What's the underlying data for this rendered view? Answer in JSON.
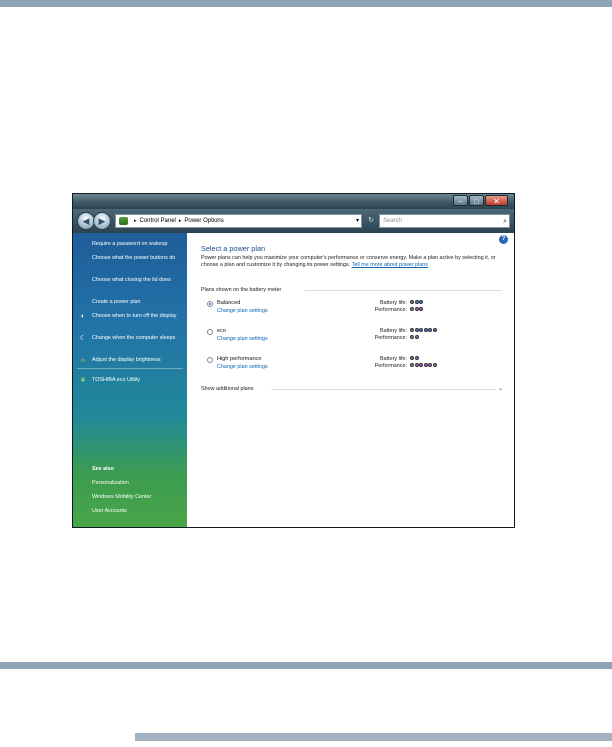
{
  "window": {
    "controls": {
      "minimize": "–",
      "maximize": "□",
      "close": "✕"
    }
  },
  "address": {
    "back": "◀",
    "forward": "▶",
    "breadcrumb": [
      "Control Panel",
      "Power Options"
    ],
    "separator": "▸",
    "dropdown": "▾",
    "refresh": "↻",
    "search_placeholder": "Search"
  },
  "sidebar": {
    "tasks": [
      {
        "label": "Require a password on wakeup"
      },
      {
        "label": "Choose what the power buttons do"
      },
      {
        "label": "Choose what closing the lid does"
      },
      {
        "label": "Create a power plan"
      },
      {
        "label": "Choose when to turn off the display",
        "icon": "display-icon"
      },
      {
        "label": "Change when the computer sleeps",
        "icon": "moon-icon"
      },
      {
        "label": "Adjust the display brightness",
        "icon": "sun-icon"
      }
    ],
    "utility": {
      "label": "TOSHIBA eco Utility",
      "icon": "leaf-icon"
    },
    "see_also": {
      "heading": "See also",
      "links": [
        "Personalization",
        "Windows Mobility Center",
        "User Accounts"
      ]
    }
  },
  "main": {
    "title": "Select a power plan",
    "intro": "Power plans can help you maximize your computer's performance or conserve energy. Make a plan active by selecting it, or choose a plan and customize it by changing its power settings.",
    "intro_link": "Tell me more about power plans",
    "section_label": "Plans shown on the battery meter",
    "battery_label": "Battery life:",
    "performance_label": "Performance:",
    "change_settings_label": "Change plan settings",
    "plans": [
      {
        "name": "Balanced",
        "selected": true,
        "battery_life": 3,
        "performance": 3
      },
      {
        "name": "eco",
        "selected": false,
        "battery_life": 6,
        "performance": 2
      },
      {
        "name": "High performance",
        "selected": false,
        "battery_life": 2,
        "performance": 6
      }
    ],
    "additional_label": "Show additional plans",
    "colors": {
      "battery": "#4d7bd6",
      "performance": "#b55fc9"
    }
  }
}
